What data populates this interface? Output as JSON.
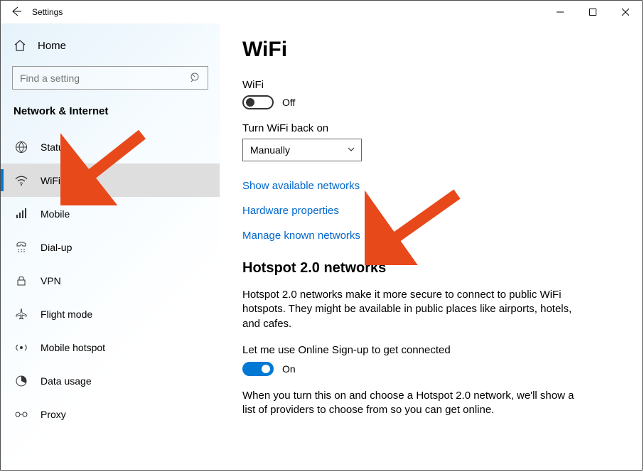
{
  "title": "Settings",
  "sidebar": {
    "home": "Home",
    "search_placeholder": "Find a setting",
    "category": "Network & Internet",
    "items": [
      {
        "label": "Status"
      },
      {
        "label": "WiFi"
      },
      {
        "label": "Mobile"
      },
      {
        "label": "Dial-up"
      },
      {
        "label": "VPN"
      },
      {
        "label": "Flight mode"
      },
      {
        "label": "Mobile hotspot"
      },
      {
        "label": "Data usage"
      },
      {
        "label": "Proxy"
      }
    ]
  },
  "main": {
    "heading": "WiFi",
    "wifi_label": "WiFi",
    "wifi_state": "Off",
    "turn_back_label": "Turn WiFi back on",
    "turn_back_value": "Manually",
    "link_show": "Show available networks",
    "link_hw": "Hardware properties",
    "link_manage": "Manage known networks",
    "hotspot_heading": "Hotspot 2.0 networks",
    "hotspot_desc": "Hotspot 2.0 networks make it more secure to connect to public WiFi hotspots. They might be available in public places like airports, hotels, and cafes.",
    "online_label": "Let me use Online Sign-up to get connected",
    "online_state": "On",
    "online_desc": "When you turn this on and choose a Hotspot 2.0 network, we'll show a list of providers to choose from so you can get online."
  }
}
